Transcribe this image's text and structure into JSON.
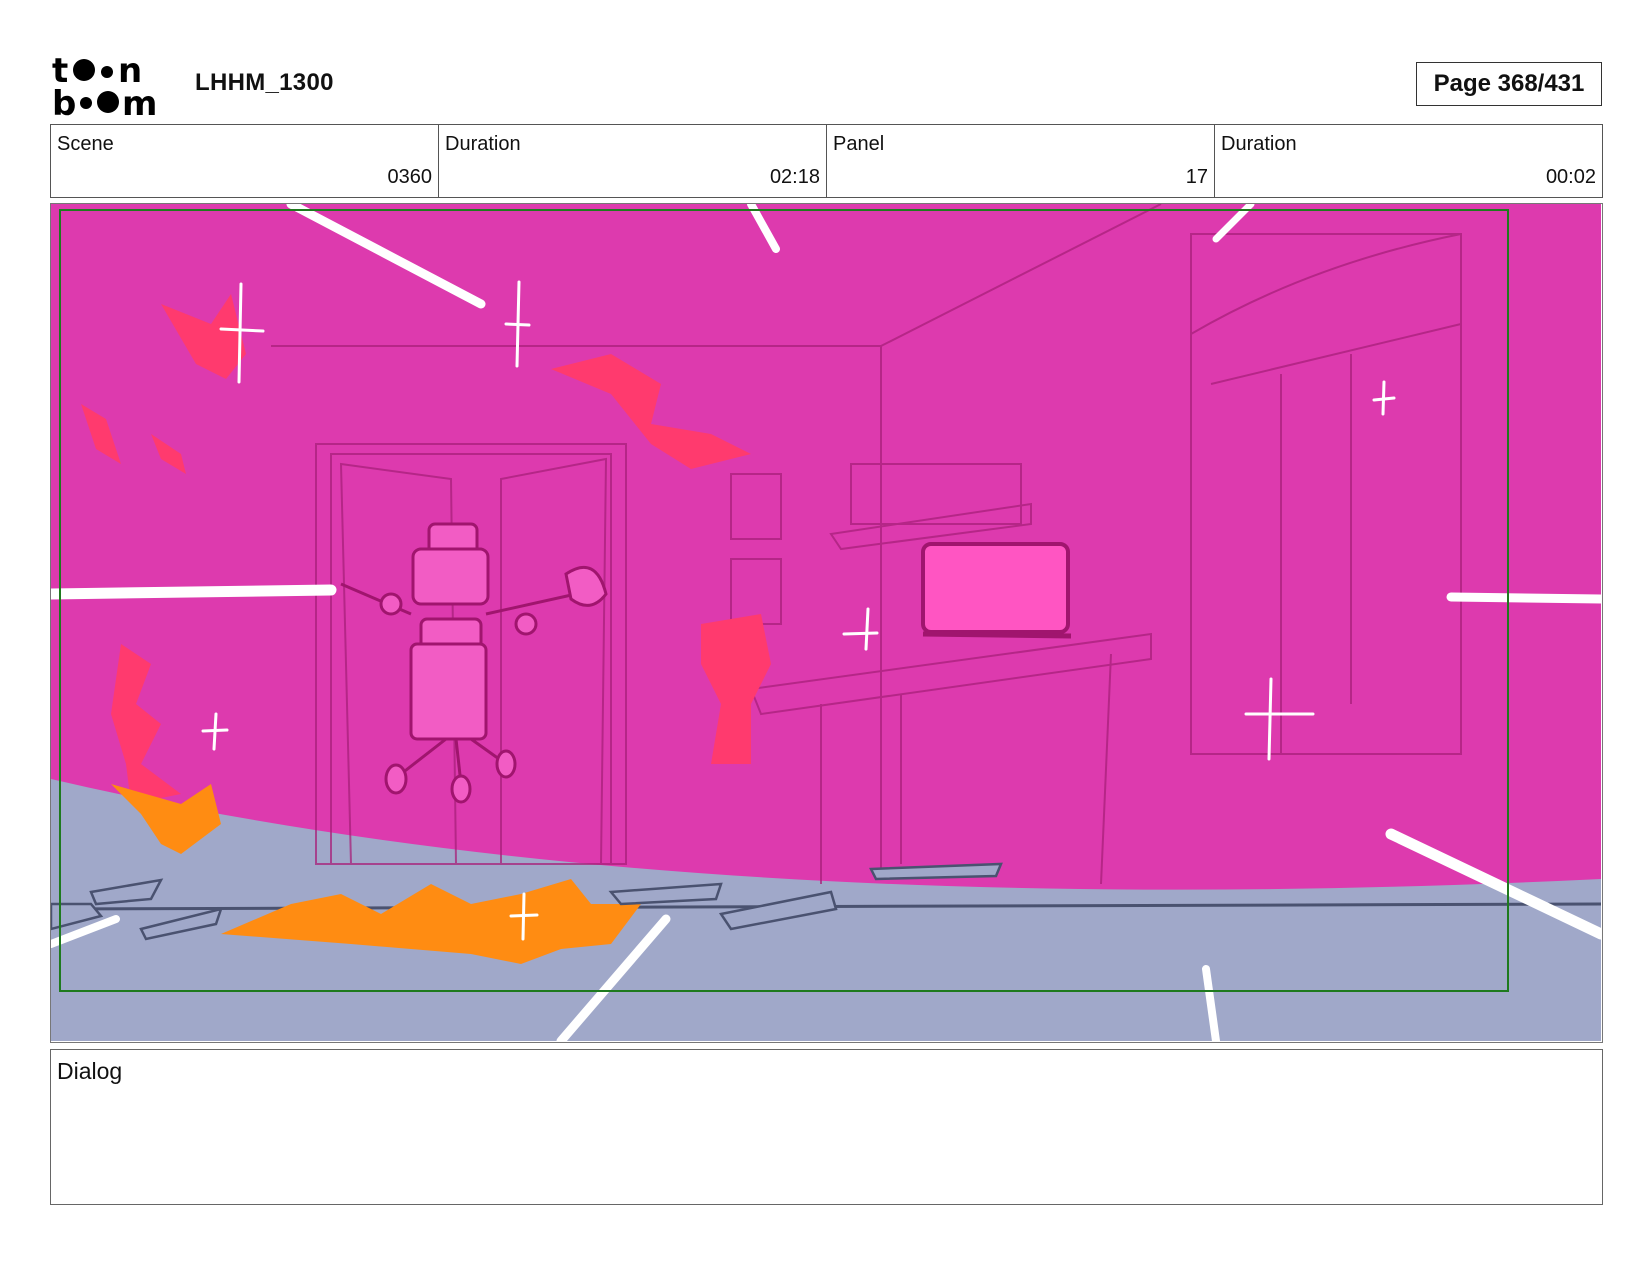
{
  "header": {
    "logo_alt": "toon boom",
    "project": "LHHM_1300",
    "page": "Page 368/431"
  },
  "info": {
    "scene_label": "Scene",
    "scene_value": "0360",
    "scene_duration_label": "Duration",
    "scene_duration_value": "02:18",
    "panel_label": "Panel",
    "panel_value": "17",
    "panel_duration_label": "Duration",
    "panel_duration_value": "00:02"
  },
  "dialog": {
    "label": "Dialog",
    "text": ""
  },
  "colors": {
    "wall_magenta": "#dd3aae",
    "floor_lavender": "#a0a8c9",
    "fire_red": "#ff3a6e",
    "fire_orange": "#ff8c12",
    "tv_pink": "#ff55c2",
    "safe_frame_green": "#1e7a1e"
  }
}
